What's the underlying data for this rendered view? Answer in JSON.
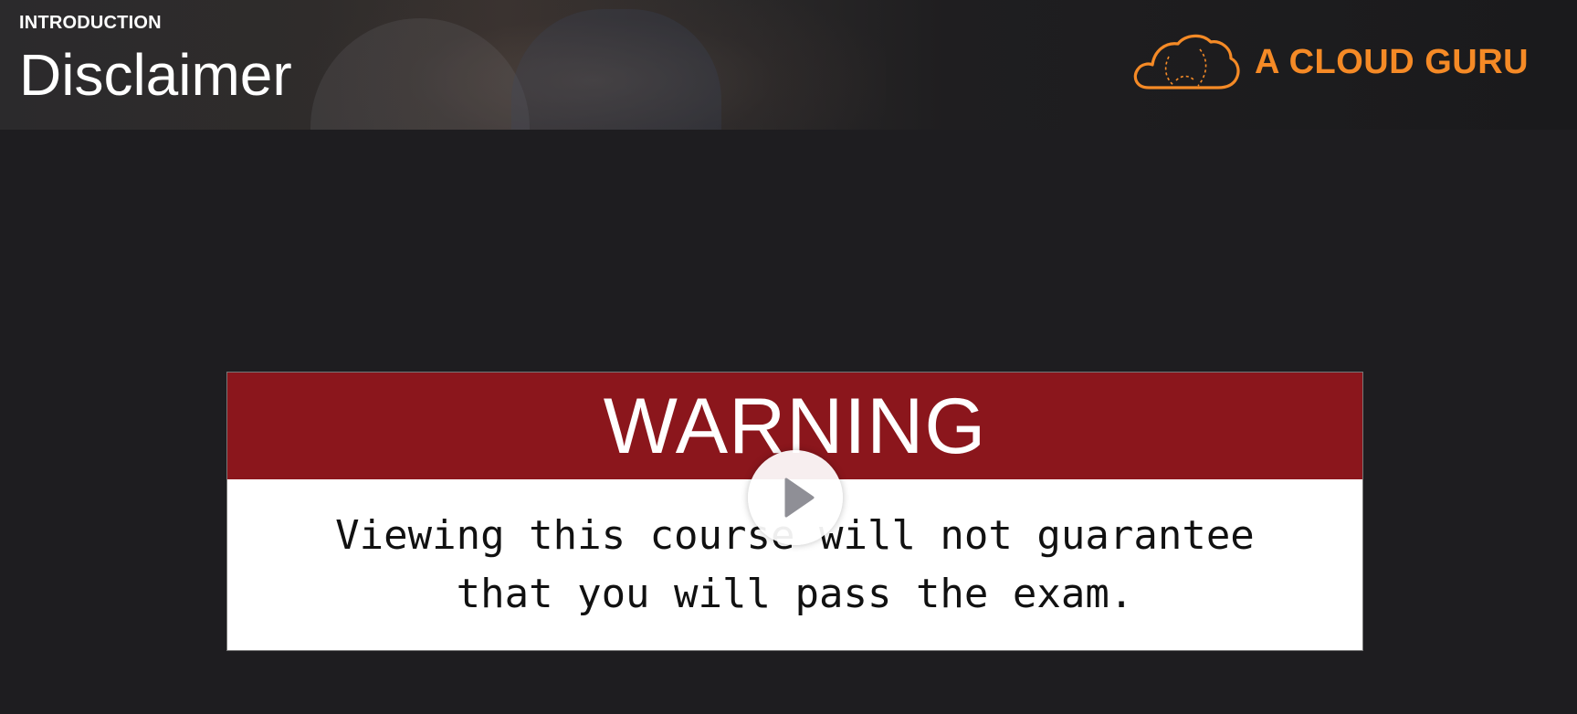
{
  "header": {
    "section_label": "INTRODUCTION",
    "title": "Disclaimer"
  },
  "brand": {
    "name": "A CLOUD GURU",
    "icon": "cloud-logo-icon",
    "color": "#f58a26"
  },
  "warning_card": {
    "heading": "WARNING",
    "body_line_1": "Viewing this course will not guarantee",
    "body_line_2": "that you will pass the exam.",
    "heading_background": "#8b161c"
  },
  "player": {
    "play_icon": "play-icon"
  }
}
